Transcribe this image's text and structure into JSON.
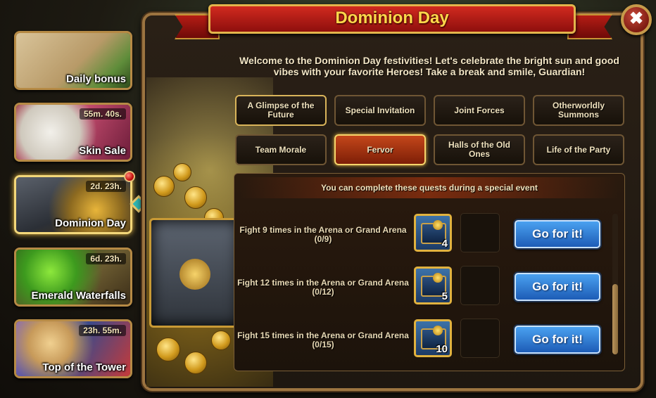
{
  "window": {
    "title": "Dominion Day",
    "close_label": "✖"
  },
  "sidebar": {
    "items": [
      {
        "label": "Daily bonus",
        "timer": ""
      },
      {
        "label": "Skin Sale",
        "timer": "55m. 40s."
      },
      {
        "label": "Dominion Day",
        "timer": "2d. 23h."
      },
      {
        "label": "Emerald Waterfalls",
        "timer": "6d. 23h."
      },
      {
        "label": "Top of the Tower",
        "timer": "23h. 55m."
      }
    ]
  },
  "welcome_text": "Welcome to the Dominion Day festivities! Let's celebrate the bright sun and good vibes with your favorite Heroes! Take a break and smile, Guardian!",
  "tabs": [
    {
      "label": "A Glimpse of the Future"
    },
    {
      "label": "Special Invitation"
    },
    {
      "label": "Joint Forces"
    },
    {
      "label": "Otherworldly Summons"
    },
    {
      "label": "Team Morale"
    },
    {
      "label": "Fervor"
    },
    {
      "label": "Halls of the Old Ones"
    },
    {
      "label": "Life of the Party"
    }
  ],
  "quests": {
    "header": "You can complete these quests during a special event",
    "items": [
      {
        "text": "Fight 9 times in the Arena or Grand Arena",
        "progress": "(0/9)",
        "reward_count": "4",
        "button": "Go for it!"
      },
      {
        "text": "Fight 12 times in the Arena or Grand Arena",
        "progress": "(0/12)",
        "reward_count": "5",
        "button": "Go for it!"
      },
      {
        "text": "Fight 15 times in the Arena or Grand Arena",
        "progress": "(0/15)",
        "reward_count": "10",
        "button": "Go for it!"
      }
    ]
  },
  "colors": {
    "title": "#ffd84a",
    "ribbon": "#d12a1f",
    "button": "#2f7fd8",
    "selected_tab": "#c4471a"
  }
}
